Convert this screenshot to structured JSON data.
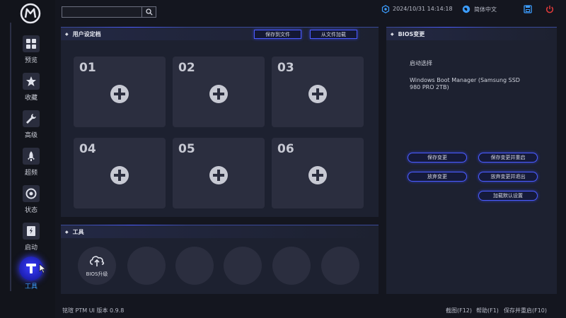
{
  "app": {
    "version_text": "铭瑄 PTM UI 版本 0.9.8"
  },
  "topbar": {
    "search_value": "",
    "datetime": "2024/10/31 14:14:18",
    "language": "简体中文"
  },
  "nav": {
    "items": [
      {
        "label": "预览",
        "icon": "grid-icon"
      },
      {
        "label": "收藏",
        "icon": "star-icon"
      },
      {
        "label": "高级",
        "icon": "wrench-icon"
      },
      {
        "label": "超频",
        "icon": "rocket-icon"
      },
      {
        "label": "状态",
        "icon": "gauge-icon"
      },
      {
        "label": "启动",
        "icon": "ssd-icon"
      },
      {
        "label": "工具",
        "icon": "tools-icon"
      }
    ],
    "active_index": 6
  },
  "profiles": {
    "title": "用户设定档",
    "save_to_file": "保存到文件",
    "load_from_file": "从文件加载",
    "slots": [
      "01",
      "02",
      "03",
      "04",
      "05",
      "06"
    ]
  },
  "tools": {
    "title": "工具",
    "items": [
      {
        "label": "BIOS升级",
        "icon": "cloud-upload-icon"
      },
      {
        "label": ""
      },
      {
        "label": ""
      },
      {
        "label": ""
      },
      {
        "label": ""
      },
      {
        "label": ""
      }
    ]
  },
  "bios": {
    "title": "BIOS变更",
    "boot_label": "启动选择",
    "boot_value_line1": "Windows Boot Manager (Samsung SSD",
    "boot_value_line2": "980 PRO 2TB)",
    "buttons": {
      "save": "保存变更",
      "save_reboot": "保存变更并重启",
      "discard": "放弃变更",
      "discard_exit": "放弃变更并退出",
      "load_defaults": "加载默认设置"
    }
  },
  "footer": {
    "screenshot": "截图(F12)",
    "help": "帮助(F1)",
    "save_reboot": "保存并重启(F10)"
  },
  "colors": {
    "accent": "#4b5bff",
    "active_label": "#3c9dff",
    "power": "#e03a3a",
    "background": "#14161f",
    "panel": "#1d2130",
    "tile": "#2b2e3f"
  }
}
